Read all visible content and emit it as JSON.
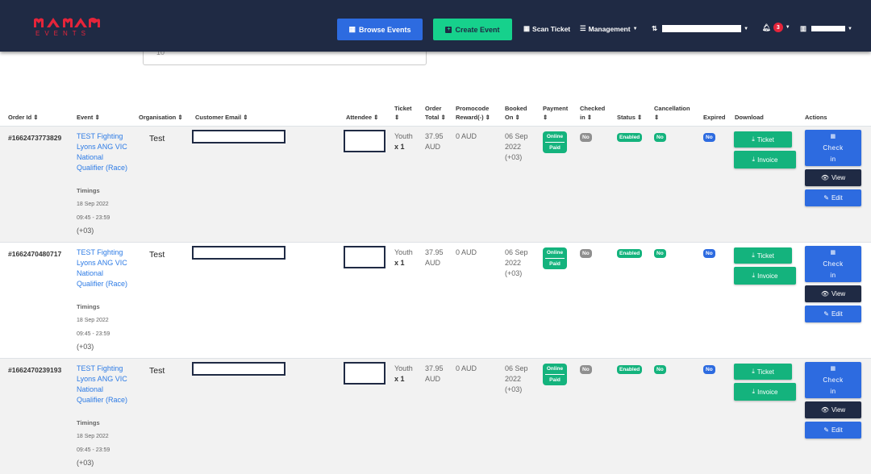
{
  "nav": {
    "logo_text": "EVENTS",
    "browse_label": "Browse Events",
    "create_label": "Create Event",
    "scan_label": "Scan Ticket",
    "management_label": "Management",
    "notification_count": "3"
  },
  "filter": {
    "value": "10"
  },
  "headers": {
    "order_id": "Order Id",
    "event": "Event",
    "organisation": "Organisation",
    "customer_email": "Customer Email",
    "attendee": "Attendee",
    "ticket_1": "Ticket",
    "order_1": "Order",
    "order_2": "Total",
    "promo_1": "Promocode",
    "promo_2": "Reward(-)",
    "booked_1": "Booked",
    "booked_2": "On",
    "payment": "Payment",
    "checked_1": "Checked",
    "checked_2": "in",
    "status": "Status",
    "cancellation": "Cancellation",
    "expired": "Expired",
    "download": "Download",
    "actions": "Actions"
  },
  "rows": [
    {
      "order_id": "#1662473773829",
      "event_line1": "TEST Fighting",
      "event_line2": "Lyons ANG VIC",
      "event_line3": "National",
      "event_line4": "Qualifier (Race)",
      "timings_label": "Timings",
      "date": "18 Sep 2022",
      "time": "09:45 - 23:59",
      "tz": "(+03)",
      "organisation": "Test",
      "ticket_type": "Youth",
      "ticket_qty": "x 1",
      "total_amount": "37.95",
      "total_currency": "AUD",
      "promo": "0 AUD",
      "booked_date": "06 Sep",
      "booked_year": "2022",
      "booked_tz": "(+03)",
      "payment_method": "Online",
      "payment_status": "Paid",
      "checked_in": "No",
      "status": "Enabled",
      "cancellation": "No",
      "expired": "No",
      "ticket_btn": "Ticket",
      "invoice_btn": "Invoice",
      "checkin_1": "Check",
      "checkin_2": "in",
      "view_btn": "View",
      "edit_btn": "Edit"
    },
    {
      "order_id": "#1662470480717",
      "event_line1": "TEST Fighting",
      "event_line2": "Lyons ANG VIC",
      "event_line3": "National",
      "event_line4": "Qualifier (Race)",
      "timings_label": "Timings",
      "date": "18 Sep 2022",
      "time": "09:45 - 23:59",
      "tz": "(+03)",
      "organisation": "Test",
      "ticket_type": "Youth",
      "ticket_qty": "x 1",
      "total_amount": "37.95",
      "total_currency": "AUD",
      "promo": "0 AUD",
      "booked_date": "06 Sep",
      "booked_year": "2022",
      "booked_tz": "(+03)",
      "payment_method": "Online",
      "payment_status": "Paid",
      "checked_in": "No",
      "status": "Enabled",
      "cancellation": "No",
      "expired": "No",
      "ticket_btn": "Ticket",
      "invoice_btn": "Invoice",
      "checkin_1": "Check",
      "checkin_2": "in",
      "view_btn": "View",
      "edit_btn": "Edit"
    },
    {
      "order_id": "#1662470239193",
      "event_line1": "TEST Fighting",
      "event_line2": "Lyons ANG VIC",
      "event_line3": "National",
      "event_line4": "Qualifier (Race)",
      "timings_label": "Timings",
      "date": "18 Sep 2022",
      "time": "09:45 - 23:59",
      "tz": "(+03)",
      "organisation": "Test",
      "ticket_type": "Youth",
      "ticket_qty": "x 1",
      "total_amount": "37.95",
      "total_currency": "AUD",
      "promo": "0 AUD",
      "booked_date": "06 Sep",
      "booked_year": "2022",
      "booked_tz": "(+03)",
      "payment_method": "Online",
      "payment_status": "Paid",
      "checked_in": "No",
      "status": "Enabled",
      "cancellation": "No",
      "expired": "No",
      "ticket_btn": "Ticket",
      "invoice_btn": "Invoice",
      "checkin_1": "Check",
      "checkin_2": "in",
      "view_btn": "View",
      "edit_btn": "Edit"
    }
  ],
  "colors": {
    "navbar": "#1f2a44",
    "primary": "#2d6be0",
    "success": "#14b37d",
    "accent": "#16d18c",
    "brand": "#e5243a"
  }
}
